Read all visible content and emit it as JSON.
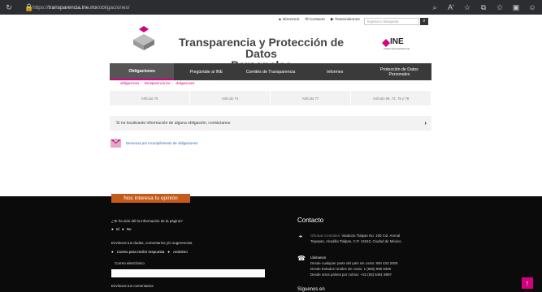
{
  "browser": {
    "url_prefix": "https://",
    "url_host": "transparencia.ine.mx",
    "url_path": "/obligaciones/",
    "icons": [
      "reload-icon",
      "lock-icon",
      "search-icon",
      "read-aloud-icon",
      "favorite-icon",
      "extensions-icon",
      "favorites-bar-icon",
      "collections-icon",
      "profile-icon"
    ]
  },
  "header": {
    "links": [
      "Directorio",
      "Contacto",
      "Transmisiones"
    ],
    "search_placeholder": "Ingresa tu búsqueda",
    "title_line1": "Transparencia y Protección de Datos",
    "title_line2": "Personales",
    "ine_label": "INE",
    "ine_subtitle": "Instituto Nacional Electoral"
  },
  "nav": {
    "items": [
      "Obligaciones",
      "Pregúntale al INE",
      "Comités de Transparencia",
      "Informes",
      "Protección de Datos Personales"
    ]
  },
  "breadcrumb": [
    "obligaciones",
    "transparencia.ine",
    "obligaciones"
  ],
  "articles": [
    "Artículo 70",
    "Artículo 74",
    "Artículo 77",
    "Artículo 68, 74, 75 y 78"
  ],
  "notfound_text": "Si no localizaste información de alguna obligación, contáctanos",
  "denuncia_text": "Denuncia por incumplimiento de obligaciones",
  "footer": {
    "tab": "Nos interesa tu opinión",
    "question": "¿Te ha sido útil la información de la página?",
    "opt_si": "Sí",
    "opt_no": "No",
    "comments_prompt": "Envíanos tus dudas, comentarios y/o sugerencias.",
    "opt_email": "Correo para recibir respuesta",
    "opt_anon": "Anónimo",
    "email_label": "Correo electrónico",
    "send_comments": "Envíanos tus comentarios",
    "contact_title": "Contacto",
    "address_label": "Oficinas Centrales:",
    "address_line1": "Viaducto Tlalpan No. 100 Col. Arenal",
    "address_line2": "Tepepan, Alcaldía Tlalpan, C.P. 14610, Ciudad de México.",
    "phone_title": "Llámanos",
    "phone1": "Desde cualquier parte del país sin costo: 800 433 2000",
    "phone2": "Desde Estados Unidos sin costo: 1 (866) 986 8306",
    "phone3": "Desde otros países por cobrar: +52 (55) 5481 9897",
    "more": "Síguenos en"
  }
}
